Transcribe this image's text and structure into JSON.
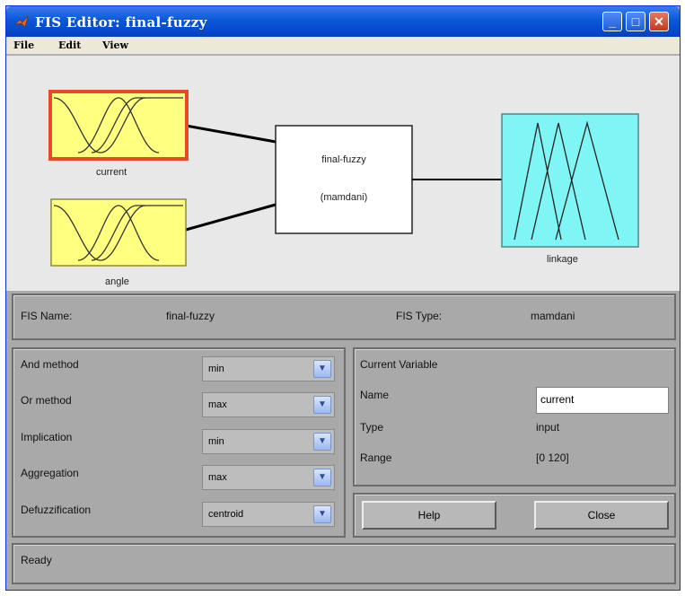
{
  "window": {
    "title": "FIS Editor: final-fuzzy"
  },
  "menu": [
    "File",
    "Edit",
    "View"
  ],
  "diagram": {
    "inputs": [
      "current",
      "angle"
    ],
    "system_name": "final-fuzzy",
    "system_type": "(mamdani)",
    "output": "linkage"
  },
  "info": {
    "fis_name_label": "FIS Name:",
    "fis_name_value": "final-fuzzy",
    "fis_type_label": "FIS Type:",
    "fis_type_value": "mamdani"
  },
  "methods": [
    {
      "label": "And method",
      "value": "min"
    },
    {
      "label": "Or method",
      "value": "max"
    },
    {
      "label": "Implication",
      "value": "min"
    },
    {
      "label": "Aggregation",
      "value": "max"
    },
    {
      "label": "Defuzzification",
      "value": "centroid"
    }
  ],
  "current_variable": {
    "heading": "Current Variable",
    "name_label": "Name",
    "name_value": "current",
    "type_label": "Type",
    "type_value": "input",
    "range_label": "Range",
    "range_value": "[0 120]"
  },
  "buttons": {
    "help": "Help",
    "close": "Close"
  },
  "status": "Ready",
  "colors": {
    "input_fill": "#ffff80",
    "output_fill": "#7ff5f5",
    "selected_border": "#e8492a",
    "titlebar": "#0a58d8"
  },
  "icons": {
    "app": "matlab-logo-icon",
    "minimize": "minimize-icon",
    "maximize": "maximize-icon",
    "close": "close-icon",
    "dropdown": "chevron-down-icon"
  }
}
